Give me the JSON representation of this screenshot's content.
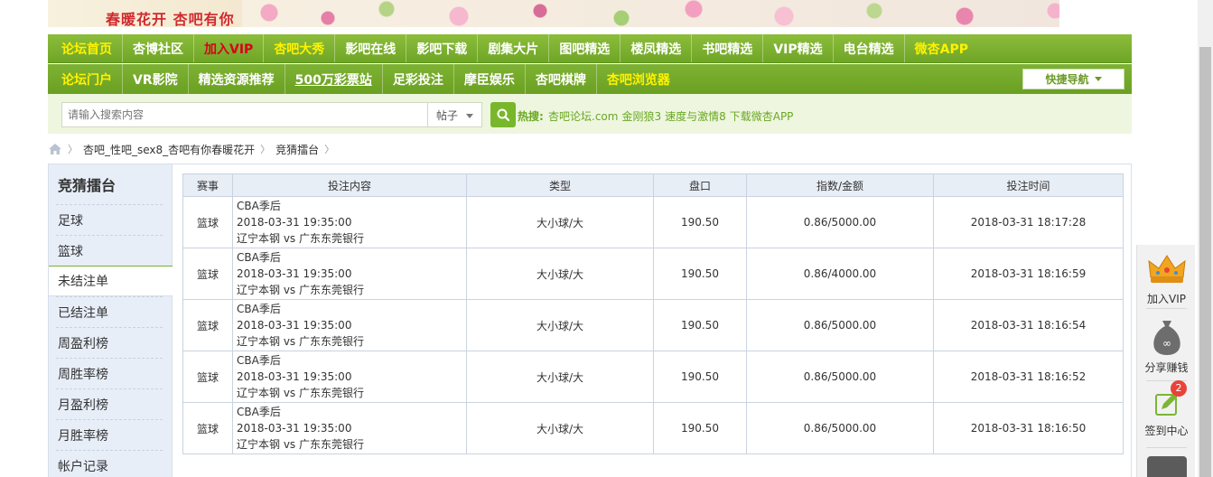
{
  "header": {
    "logo_text": "春暖花开 杏吧有你"
  },
  "nav_row1": [
    {
      "label": "论坛首页",
      "style": "yellow"
    },
    {
      "label": "杏博社区",
      "style": "white"
    },
    {
      "label": "加入VIP",
      "style": "red"
    },
    {
      "label": "杏吧大秀",
      "style": "yellow"
    },
    {
      "label": "影吧在线",
      "style": "white"
    },
    {
      "label": "影吧下载",
      "style": "white"
    },
    {
      "label": "剧集大片",
      "style": "white"
    },
    {
      "label": "图吧精选",
      "style": "white"
    },
    {
      "label": "楼凤精选",
      "style": "white"
    },
    {
      "label": "书吧精选",
      "style": "white"
    },
    {
      "label": "VIP精选",
      "style": "white"
    },
    {
      "label": "电台精选",
      "style": "white"
    },
    {
      "label": "微杏APP",
      "style": "yellow"
    }
  ],
  "nav_row2": [
    {
      "label": "论坛门户",
      "style": "yellow"
    },
    {
      "label": "VR影院",
      "style": "white"
    },
    {
      "label": "精选资源推荐",
      "style": "white"
    },
    {
      "label": "500万彩票站",
      "style": "white-u"
    },
    {
      "label": "足彩投注",
      "style": "white"
    },
    {
      "label": "摩臣娱乐",
      "style": "white"
    },
    {
      "label": "杏吧棋牌",
      "style": "white"
    },
    {
      "label": "杏吧浏览器",
      "style": "yellow"
    }
  ],
  "quick_nav": {
    "label": "快捷导航"
  },
  "search": {
    "placeholder": "请输入搜索内容",
    "scope": "帖子",
    "hot_label": "热搜:",
    "hot_links": [
      "杏吧论坛.com",
      "金刚狼3",
      "速度与激情8",
      "下载微杏APP"
    ]
  },
  "breadcrumb": [
    "杏吧_性吧_sex8_杏吧有你春暖花开",
    "竞猜擂台"
  ],
  "sidebar": {
    "title": "竞猜擂台",
    "items": [
      "足球",
      "篮球",
      "未结注单",
      "已结注单",
      "周盈利榜",
      "周胜率榜",
      "月盈利榜",
      "月胜率榜",
      "帐户记录"
    ],
    "active_index": 2
  },
  "table": {
    "headers": [
      "赛事",
      "投注内容",
      "类型",
      "盘口",
      "指数/金额",
      "投注时间"
    ],
    "rows": [
      {
        "event": "篮球",
        "league": "CBA季后",
        "match_time": "2018-03-31 19:35:00",
        "teams": "辽宁本钢 vs 广东东莞银行",
        "type": "大小球/大",
        "line": "190.50",
        "odds_amount": "0.86/5000.00",
        "bet_time": "2018-03-31 18:17:28"
      },
      {
        "event": "篮球",
        "league": "CBA季后",
        "match_time": "2018-03-31 19:35:00",
        "teams": "辽宁本钢 vs 广东东莞银行",
        "type": "大小球/大",
        "line": "190.50",
        "odds_amount": "0.86/4000.00",
        "bet_time": "2018-03-31 18:16:59"
      },
      {
        "event": "篮球",
        "league": "CBA季后",
        "match_time": "2018-03-31 19:35:00",
        "teams": "辽宁本钢 vs 广东东莞银行",
        "type": "大小球/大",
        "line": "190.50",
        "odds_amount": "0.86/5000.00",
        "bet_time": "2018-03-31 18:16:54"
      },
      {
        "event": "篮球",
        "league": "CBA季后",
        "match_time": "2018-03-31 19:35:00",
        "teams": "辽宁本钢 vs 广东东莞银行",
        "type": "大小球/大",
        "line": "190.50",
        "odds_amount": "0.86/5000.00",
        "bet_time": "2018-03-31 18:16:52"
      },
      {
        "event": "篮球",
        "league": "CBA季后",
        "match_time": "2018-03-31 19:35:00",
        "teams": "辽宁本钢 vs 广东东莞银行",
        "type": "大小球/大",
        "line": "190.50",
        "odds_amount": "0.86/5000.00",
        "bet_time": "2018-03-31 18:16:50"
      }
    ]
  },
  "floatbar": {
    "vip_label": "加入VIP",
    "share_label": "分享赚钱",
    "checkin_label": "签到中心",
    "checkin_badge": "2"
  },
  "colors": {
    "nav_green": "#7eb233",
    "accent_yellow": "#fff200",
    "vip_red": "#d8001c",
    "hot_green": "#6aa722"
  }
}
